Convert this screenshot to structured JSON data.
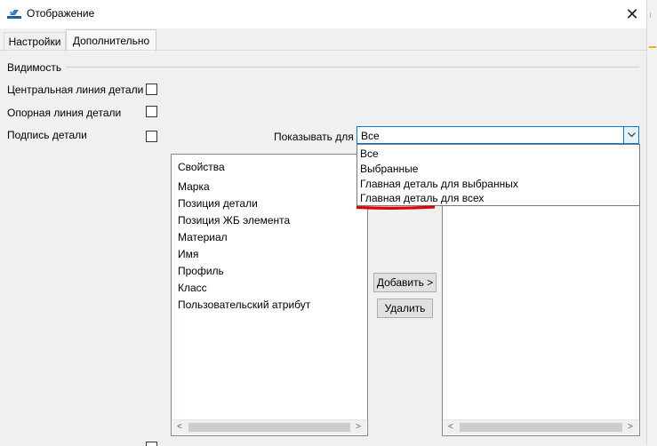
{
  "window": {
    "title": "Отображение",
    "close_glyph": "✕"
  },
  "tabs": [
    {
      "label": "Настройки"
    },
    {
      "label": "Дополнительно",
      "active": true
    }
  ],
  "visibility": {
    "section_label": "Видимость",
    "checkboxes": [
      {
        "label": "Центральная линия детали",
        "checked": false
      },
      {
        "label": "Опорная линия детали",
        "checked": false
      },
      {
        "label": "Подпись детали",
        "checked": false
      }
    ]
  },
  "show_for": {
    "label": "Показывать для",
    "value": "Все",
    "options": [
      "Все",
      "Выбранные",
      "Главная деталь для выбранных",
      "Главная деталь для всех"
    ]
  },
  "properties_list": {
    "header": "Свойства",
    "items": [
      "Марка",
      "Позиция детали",
      "Позиция ЖБ элемента",
      "Материал",
      "Имя",
      "Профиль",
      "Класс",
      "Пользовательский атрибут"
    ]
  },
  "buttons": {
    "add": "Добавить >",
    "remove": "Удалить"
  },
  "scrollbar": {
    "left_arrow": "<",
    "right_arrow": ">"
  },
  "colors": {
    "accent": "#0078d7",
    "annotation": "#e00000"
  }
}
